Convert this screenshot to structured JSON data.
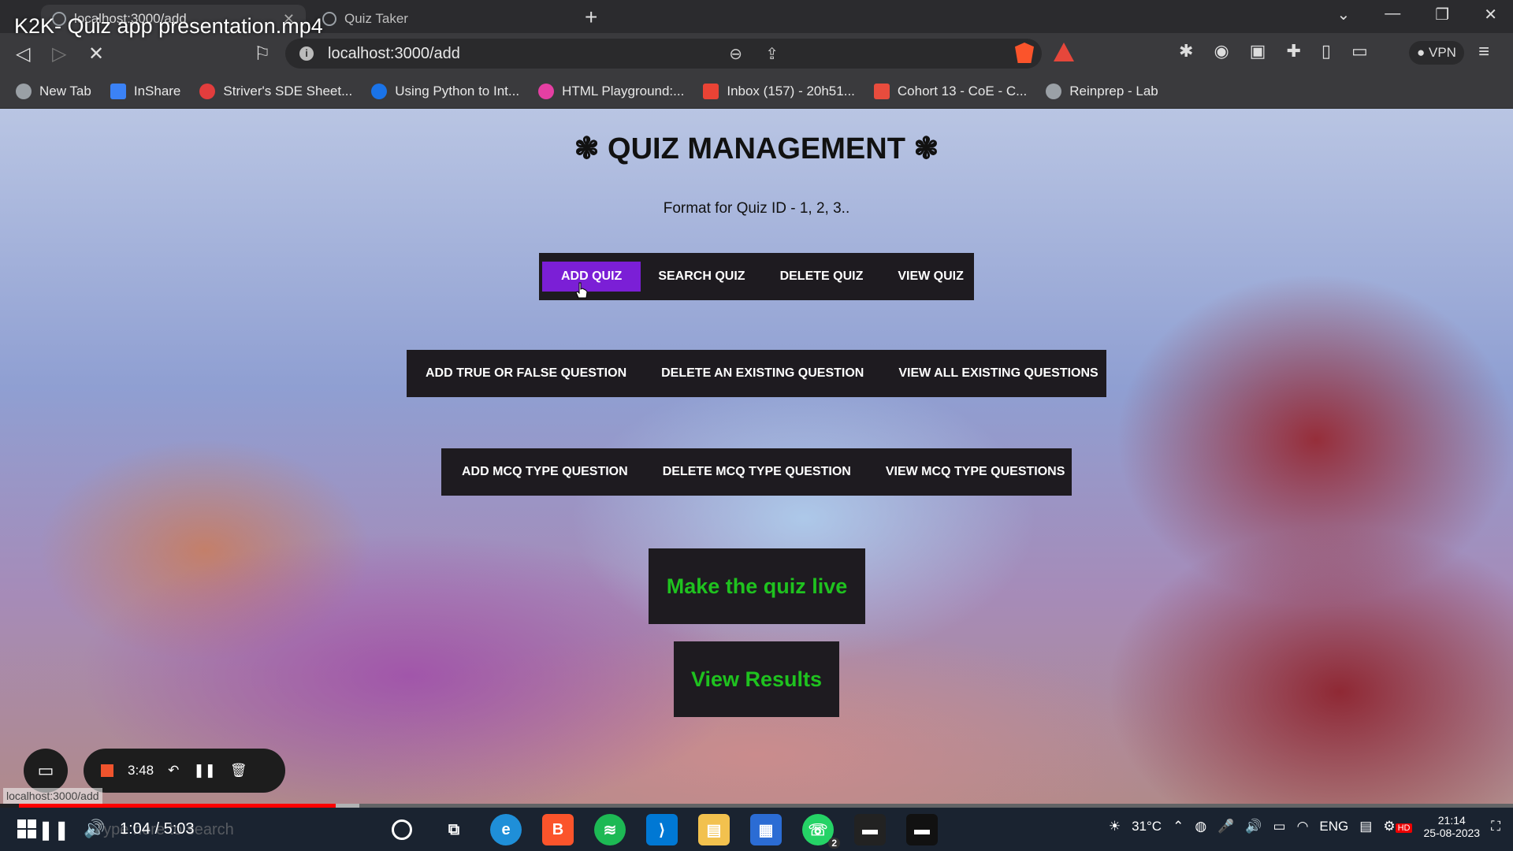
{
  "video": {
    "title": "K2K- Quiz app presentation.mp4",
    "time": "1:04 / 5:03",
    "progress": 0.212,
    "hd_label": "HD"
  },
  "browser": {
    "tabs": [
      {
        "label": "localhost:3000/add",
        "active": true
      },
      {
        "label": "Quiz Taker",
        "active": false
      }
    ],
    "new_tab": "+",
    "url": "localhost:3000/add",
    "vpn_label": "VPN",
    "bookmarks": [
      {
        "label": "New Tab",
        "color": "#9aa0a6"
      },
      {
        "label": "InShare",
        "color": "#3b82f6"
      },
      {
        "label": "Striver's SDE Sheet...",
        "color": "#e23d3d"
      },
      {
        "label": "Using Python to Int...",
        "color": "#1a73e8"
      },
      {
        "label": "HTML Playground:...",
        "color": "#e53fa3"
      },
      {
        "label": "Inbox (157) - 20h51...",
        "color": "#ea4335"
      },
      {
        "label": "Cohort 13 - CoE - C...",
        "color": "#e84c3d"
      },
      {
        "label": "Reinprep - Lab",
        "color": "#9aa0a6"
      }
    ],
    "status_url": "localhost:3000/add"
  },
  "page": {
    "title": "❃ QUIZ MANAGEMENT ❃",
    "format_note": "Format for Quiz ID - 1, 2, 3..",
    "quiz_nav": [
      "ADD QUIZ",
      "SEARCH QUIZ",
      "DELETE QUIZ",
      "VIEW QUIZ"
    ],
    "tf_nav": [
      "ADD TRUE OR FALSE QUESTION",
      "DELETE AN EXISTING QUESTION",
      "VIEW ALL EXISTING QUESTIONS"
    ],
    "mcq_nav": [
      "ADD MCQ TYPE QUESTION",
      "DELETE MCQ TYPE QUESTION",
      "VIEW MCQ TYPE QUESTIONS"
    ],
    "live_button": "Make the quiz live",
    "results_button": "View Results",
    "accent_color": "#7b1fd6",
    "button_text_color": "#1fc21f"
  },
  "recorder": {
    "timer": "3:48"
  },
  "taskbar": {
    "search_placeholder": "Type here to search",
    "temperature": "31°C",
    "language": "ENG",
    "clock_time": "21:14",
    "clock_date": "25-08-2023",
    "whatsapp_badge": "2"
  }
}
